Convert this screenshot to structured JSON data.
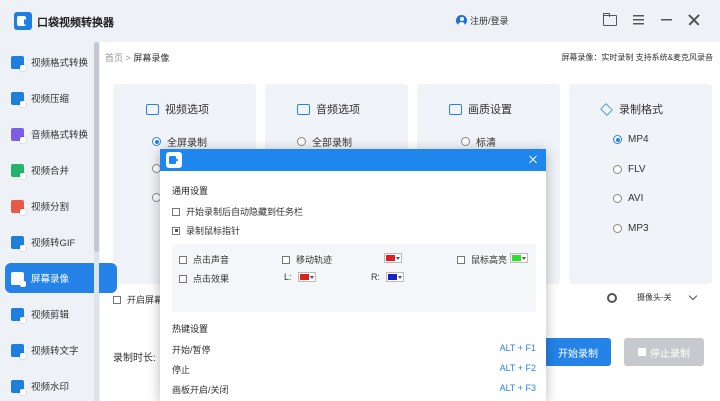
{
  "app": {
    "title": "口袋视频转换器",
    "login": "注册/登录"
  },
  "sidebar": {
    "items": [
      {
        "label": "视频格式转换",
        "color": "#1e7fe0"
      },
      {
        "label": "视频压缩",
        "color": "#1e7fe0"
      },
      {
        "label": "音频格式转换",
        "color": "#7b5de6"
      },
      {
        "label": "视频合并",
        "color": "#23b46b"
      },
      {
        "label": "视频分割",
        "color": "#e8594a"
      },
      {
        "label": "视频转GIF",
        "color": "#1e7fe0"
      },
      {
        "label": "屏幕录像",
        "color": "#ffffff",
        "active": true
      },
      {
        "label": "视频剪辑",
        "color": "#1e7fe0"
      },
      {
        "label": "视频转文字",
        "color": "#1e7fe0"
      },
      {
        "label": "视频水印",
        "color": "#1e7fe0"
      }
    ]
  },
  "breadcrumb": {
    "home": "首页",
    "sep": ">",
    "current": "屏幕录像"
  },
  "tagline": "屏幕录像：实时录制 支持系统&麦克风录音",
  "cards": {
    "video": {
      "title": "视频选项",
      "option1": "全屏录制"
    },
    "audio": {
      "title": "音频选项",
      "option1": "全部录制"
    },
    "quality": {
      "title": "画质设置",
      "option1": "标清"
    },
    "format": {
      "title": "录制格式",
      "options": [
        "MP4",
        "FLV",
        "AVI",
        "MP3"
      ]
    }
  },
  "bottom": {
    "open_screen_partial": "开启屏幕",
    "duration_label": "录制时长:",
    "camera": "摄像头-关",
    "start": "开始录制",
    "stop": "停止录制"
  },
  "dialog": {
    "general_title": "通用设置",
    "opt_hide_taskbar": "开始录制后自动隐藏到任务栏",
    "opt_record_pointer": "录制鼠标指针",
    "click_sound": "点击声音",
    "move_trail": "移动轨迹",
    "mouse_highlight": "鼠标高亮",
    "click_effect": "点击效果",
    "left_label": "L:",
    "right_label": "R:",
    "colors": {
      "trail": "#e01e1e",
      "highlight": "#2ee02e",
      "left": "#e01e1e",
      "right": "#1e1ec8"
    },
    "hotkey_title": "热键设置",
    "hotkeys": [
      {
        "label": "开始/暂停",
        "key": "ALT + F1"
      },
      {
        "label": "停止",
        "key": "ALT + F2"
      },
      {
        "label": "画板开启/关闭",
        "key": "ALT + F3"
      }
    ]
  }
}
